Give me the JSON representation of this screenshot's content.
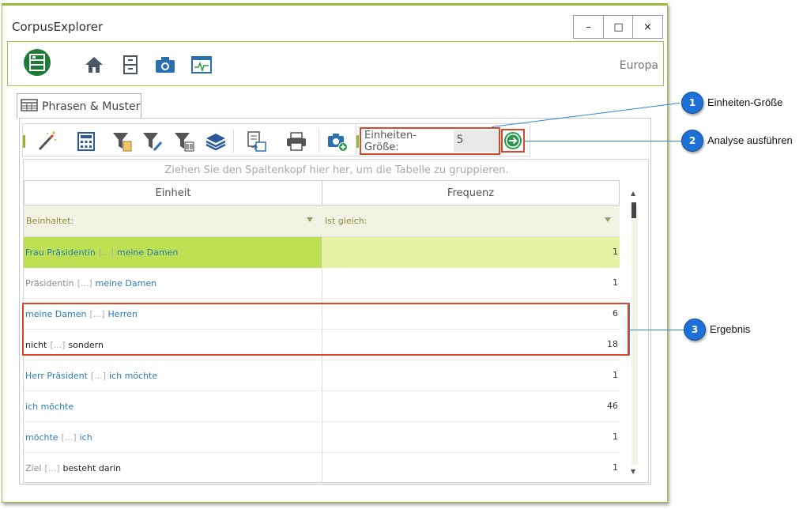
{
  "window": {
    "title": "CorpusExplorer",
    "buttons": {
      "minimize": "–",
      "maximize": "□",
      "close": "×"
    }
  },
  "ribbon": {
    "icons": [
      "corpus-logo-icon",
      "home-icon",
      "cabinet-icon",
      "camera-icon",
      "monitor-icon"
    ],
    "corpus_label": "Europa"
  },
  "tab": {
    "label": "Phrasen & Muster"
  },
  "toolbar": {
    "icons": [
      "magic-wand-icon",
      "calculator-icon",
      "filter-clipboard-icon",
      "filter-tools-icon",
      "filter-barcode-icon",
      "layers-icon",
      "export-icon",
      "print-icon",
      "snapshot-add-icon"
    ],
    "unit_size_label": "Einheiten-Größe:",
    "unit_size_value": "5",
    "run_icon": "arrow-right-circle-icon"
  },
  "grid": {
    "group_hint": "Ziehen Sie den Spaltenkopf hier her, um die Tabelle zu gruppieren.",
    "columns": [
      "Einheit",
      "Frequenz"
    ],
    "filters": [
      "Beinhaltet:",
      "Ist gleich:"
    ],
    "rows": [
      {
        "parts": [
          [
            "Frau Präsidentin",
            "blue"
          ],
          [
            "[...]",
            "gap"
          ],
          [
            "meine Damen",
            "blue"
          ]
        ],
        "freq": "1",
        "selected": true
      },
      {
        "parts": [
          [
            "Präsidentin",
            "gray"
          ],
          [
            "[...]",
            "gap"
          ],
          [
            "meine Damen",
            "blue"
          ]
        ],
        "freq": "1"
      },
      {
        "parts": [
          [
            "meine Damen",
            "blue"
          ],
          [
            "[...]",
            "gap"
          ],
          [
            "Herren",
            "blue"
          ]
        ],
        "freq": "6"
      },
      {
        "parts": [
          [
            "nicht",
            "black"
          ],
          [
            "[...]",
            "gap"
          ],
          [
            "sondern",
            "black"
          ]
        ],
        "freq": "18"
      },
      {
        "parts": [
          [
            "Herr Präsident",
            "blue"
          ],
          [
            "[...]",
            "gap"
          ],
          [
            "ich möchte",
            "blue"
          ]
        ],
        "freq": "1"
      },
      {
        "parts": [
          [
            "ich möchte",
            "blue"
          ]
        ],
        "freq": "46"
      },
      {
        "parts": [
          [
            "möchte",
            "blue"
          ],
          [
            "[...]",
            "gap"
          ],
          [
            "ich",
            "blue"
          ]
        ],
        "freq": "1"
      },
      {
        "parts": [
          [
            "Ziel",
            "gray"
          ],
          [
            "[...]",
            "gap"
          ],
          [
            "besteht darin",
            "black"
          ]
        ],
        "freq": "1"
      }
    ]
  },
  "callouts": [
    {
      "number": "1",
      "label": "Einheiten-Größe"
    },
    {
      "number": "2",
      "label": "Analyse ausführen"
    },
    {
      "number": "3",
      "label": "Ergebnis"
    }
  ],
  "colors": {
    "accent": "#9bbb38",
    "selected_row": "#bde053",
    "highlight": "#d9472b",
    "callout": "#1e6fd6",
    "link": "#2a7bb5"
  }
}
